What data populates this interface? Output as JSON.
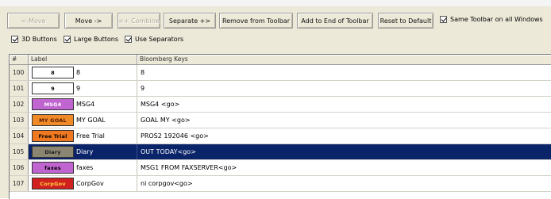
{
  "toolbar": {
    "move_left": "<-Move",
    "move_right": "Move ->",
    "combine": "<+ Combine",
    "separate": "Separate +>",
    "remove": "Remove from Toolbar",
    "add_end": "Add to End of Toolbar",
    "reset": "Reset to Default",
    "same_toolbar": "Same Toolbar on all Windows"
  },
  "options": {
    "buttons_3d": "3D Buttons",
    "large_buttons": "Large Buttons",
    "use_separators": "Use Separators"
  },
  "table": {
    "headers": {
      "num": "#",
      "label": "Label",
      "keys": "Bloomberg Keys"
    },
    "rows": [
      {
        "num": "100",
        "button_text": "8",
        "label": "8",
        "keys": "8",
        "bg": "#ffffff",
        "fg": "#000000"
      },
      {
        "num": "101",
        "button_text": "9",
        "label": "9",
        "keys": "9",
        "bg": "#ffffff",
        "fg": "#000000"
      },
      {
        "num": "102",
        "button_text": "MSG4",
        "label": "MSG4",
        "keys": "MSG4 <go>",
        "bg": "#c064d0",
        "fg": "#ffffff"
      },
      {
        "num": "103",
        "button_text": "MY GOAL",
        "label": "MY GOAL",
        "keys": "GOAL MY <go>",
        "bg": "#f08a28",
        "fg": "#5a1a00"
      },
      {
        "num": "104",
        "button_text": "Free Trial",
        "label": "Free Trial",
        "keys": "PROS2 192046 <go>",
        "bg": "#f07820",
        "fg": "#000000"
      },
      {
        "num": "105",
        "button_text": "Diary",
        "label": "Diary",
        "keys": "OUT TODAY<go>",
        "bg": "#8a8672",
        "fg": "#1a1a1a"
      },
      {
        "num": "106",
        "button_text": "faxes",
        "label": "faxes",
        "keys": "MSG1 FROM FAXSERVER<go>",
        "bg": "#c064d0",
        "fg": "#000000"
      },
      {
        "num": "107",
        "button_text": "CorpGov",
        "label": "CorpGov",
        "keys": "ni corpgov<go>",
        "bg": "#d02020",
        "fg": "#ffd040"
      }
    ],
    "selected_row": "105"
  }
}
